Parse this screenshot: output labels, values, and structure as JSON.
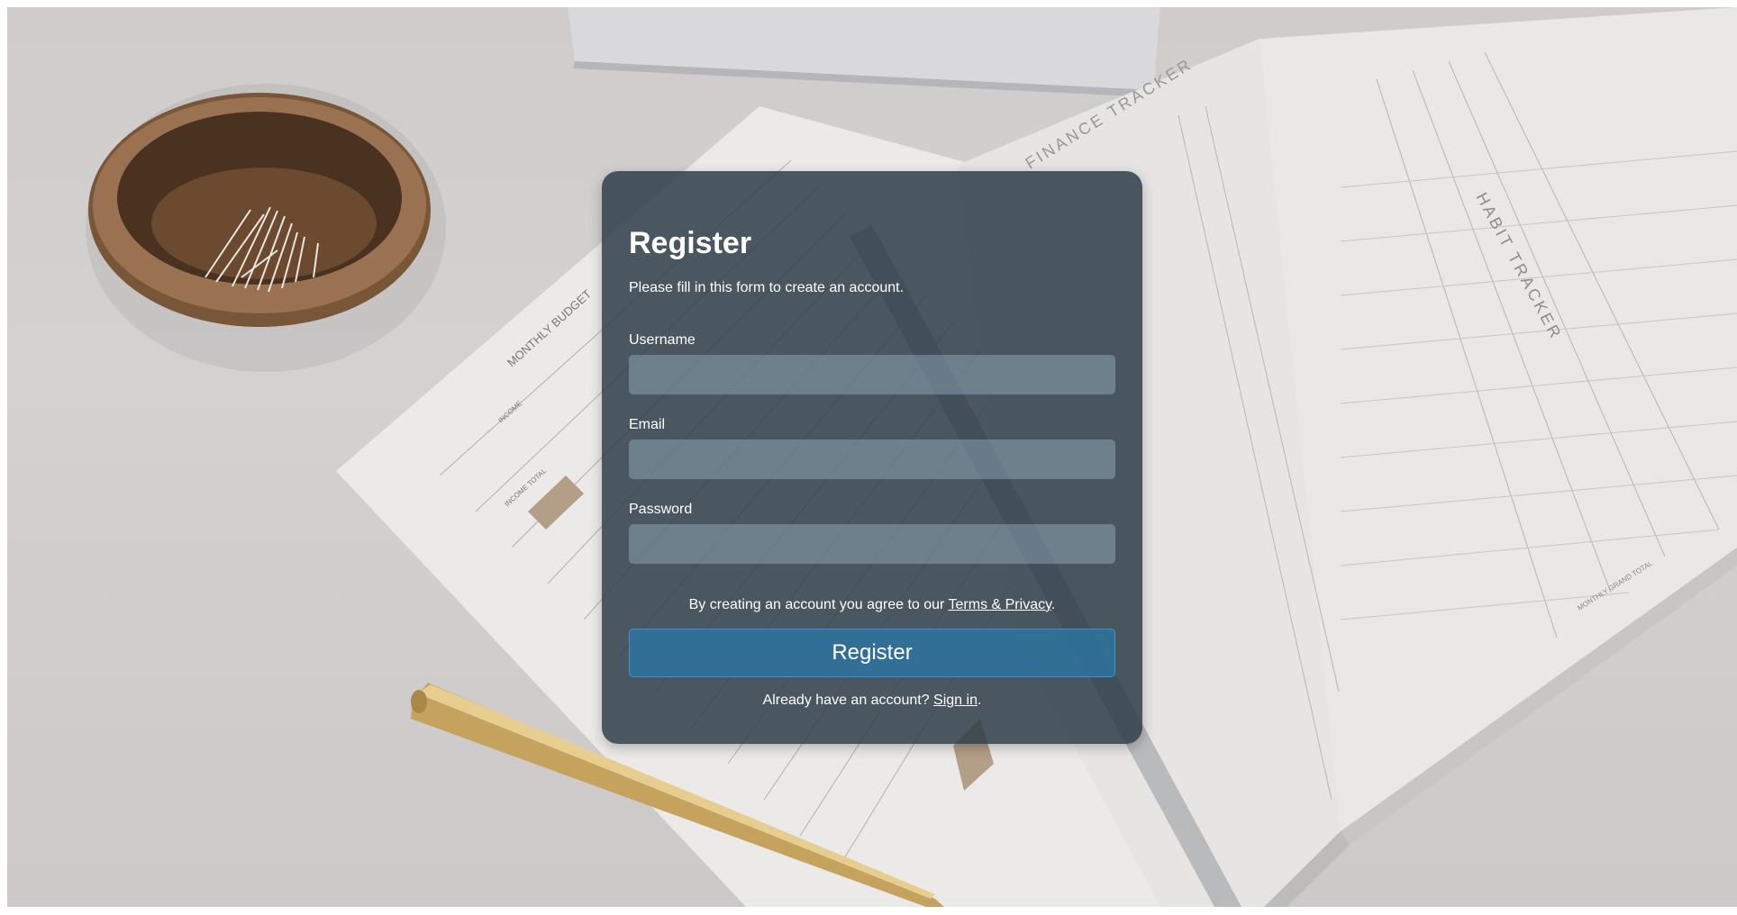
{
  "form": {
    "title": "Register",
    "subtitle": "Please fill in this form to create an account.",
    "fields": [
      {
        "label": "Username",
        "value": "",
        "placeholder": ""
      },
      {
        "label": "Email",
        "value": "",
        "placeholder": ""
      },
      {
        "label": "Password",
        "value": "",
        "placeholder": ""
      }
    ],
    "agree_text": "By creating an account you agree to our ",
    "terms_link": "Terms & Privacy",
    "agree_end": ".",
    "submit_label": "Register",
    "signin_text": "Already have an account? ",
    "signin_link": "Sign in",
    "signin_end": "."
  },
  "background": {
    "printed_text": [
      "FINANCE TRACKER",
      "HABIT TRACKER",
      "MONTHLY BUDGET",
      "INCOME",
      "INCOME TOTAL",
      "MONTHLY GRAND TOTAL"
    ]
  },
  "colors": {
    "card": "#2e3e49",
    "input": "#a0b9c8",
    "button": "#2878aa",
    "button_border": "#3a95d0"
  }
}
